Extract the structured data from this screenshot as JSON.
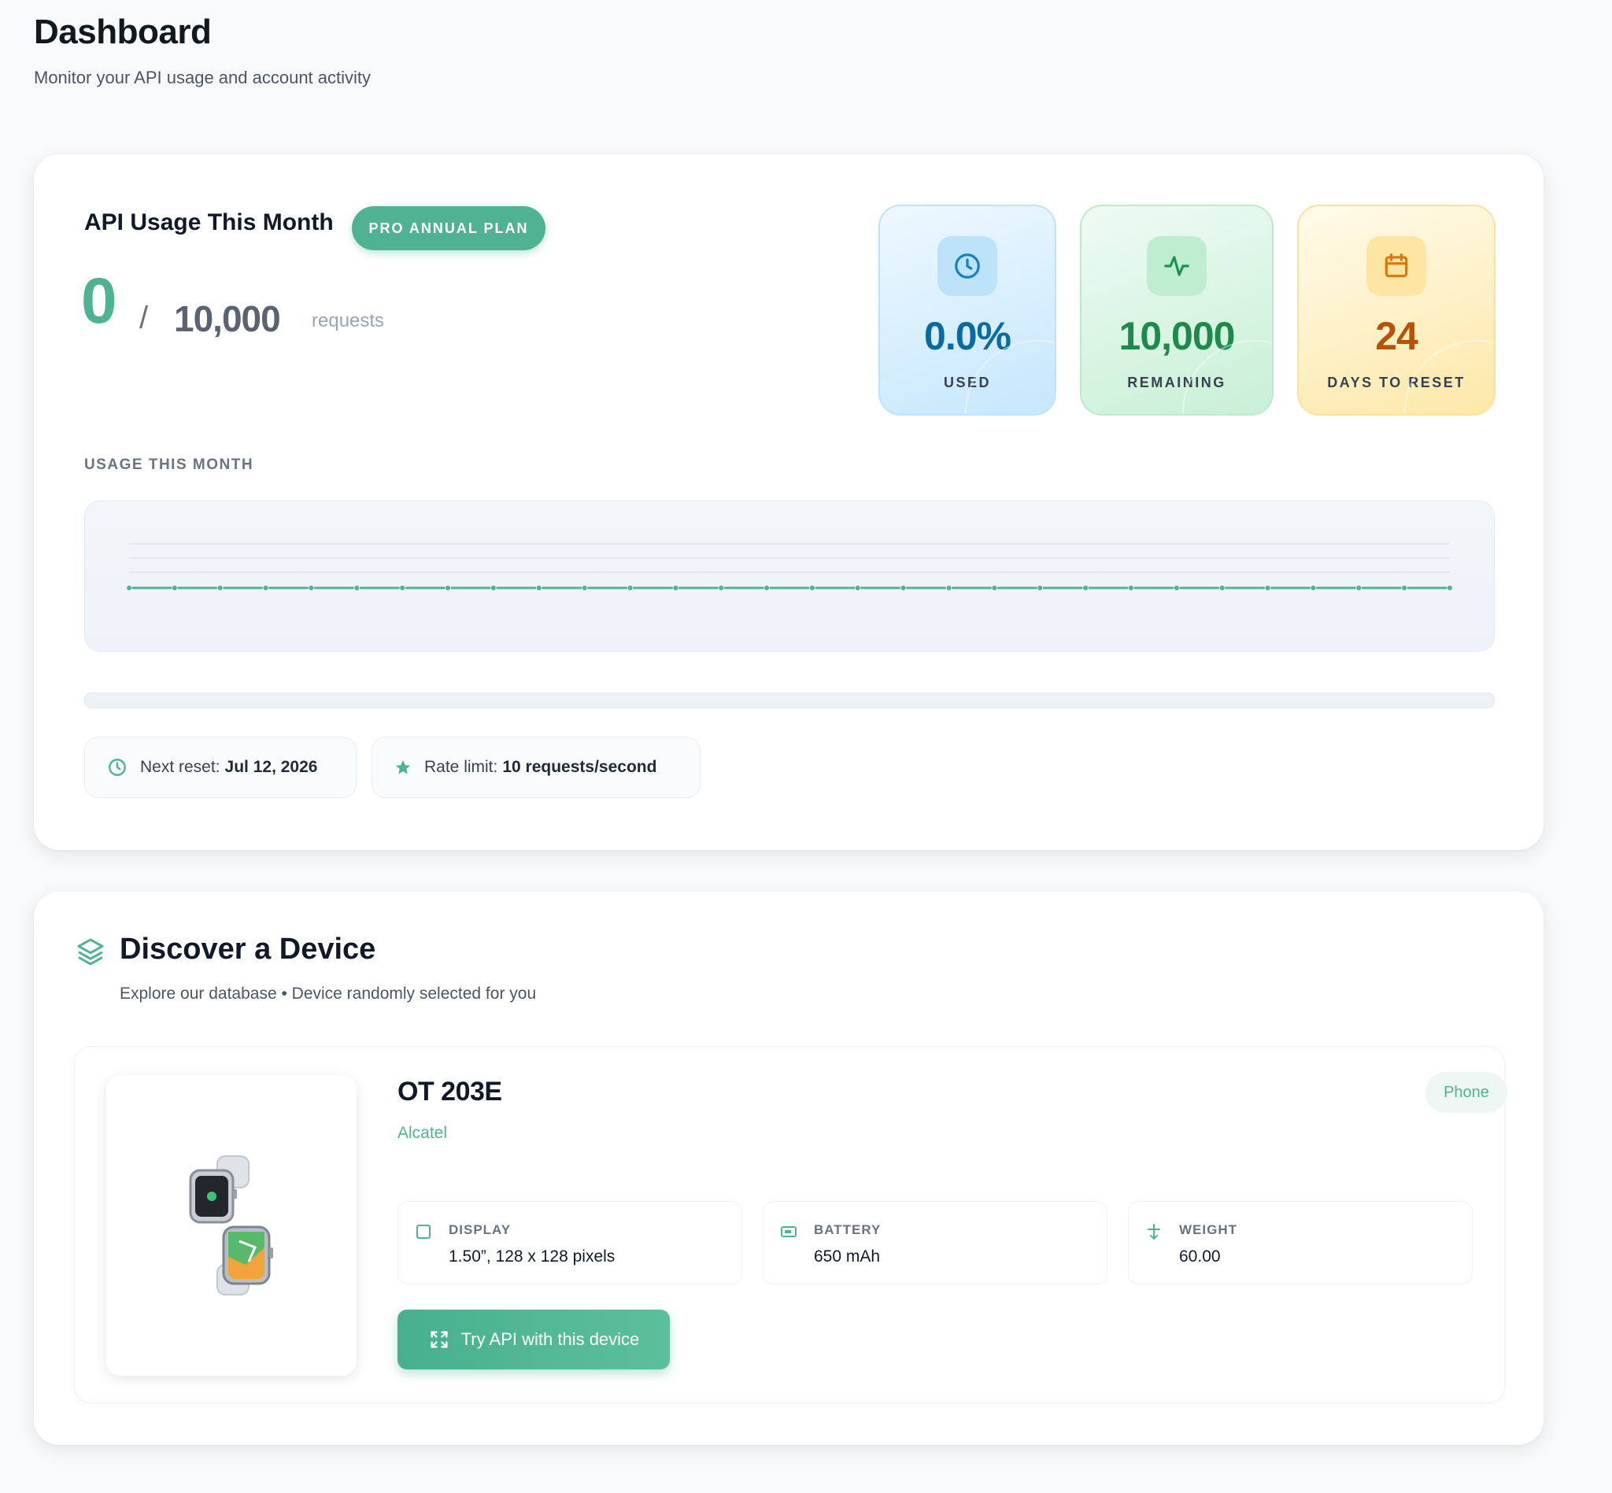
{
  "header": {
    "title": "Dashboard",
    "subtitle": "Monitor your API usage and account activity"
  },
  "usage": {
    "title": "API Usage This Month",
    "plan_badge": "PRO ANNUAL PLAN",
    "used": "0",
    "separator": "/",
    "limit": "10,000",
    "unit": "requests",
    "progress_fraction": 0.0,
    "stats": [
      {
        "icon": "clock-icon",
        "value": "0.0%",
        "label": "USED"
      },
      {
        "icon": "activity-icon",
        "value": "10,000",
        "label": "REMAINING"
      },
      {
        "icon": "calendar-icon",
        "value": "24",
        "label": "DAYS TO RESET"
      }
    ],
    "chart_label": "USAGE THIS MONTH",
    "next_reset_label": "Next reset:",
    "next_reset_value": "Jul 12, 2026",
    "rate_limit_label": "Rate limit:",
    "rate_limit_value": "10 requests/second"
  },
  "chart_data": {
    "type": "line",
    "x": [
      1,
      2,
      3,
      4,
      5,
      6,
      7,
      8,
      9,
      10,
      11,
      12,
      13,
      14,
      15,
      16,
      17,
      18,
      19,
      20,
      21,
      22,
      23,
      24,
      25,
      26,
      27,
      28,
      29,
      30
    ],
    "series": [
      {
        "values": [
          0,
          0,
          0,
          0,
          0,
          0,
          0,
          0,
          0,
          0,
          0,
          0,
          0,
          0,
          0,
          0,
          0,
          0,
          0,
          0,
          0,
          0,
          0,
          0,
          0,
          0,
          0,
          0,
          0,
          0
        ]
      }
    ],
    "grid": true,
    "color": "#4fb393"
  },
  "discover": {
    "title": "Discover a Device",
    "subtitle": "Explore our database • Device randomly selected for you",
    "device": {
      "name": "OT 203E",
      "brand": "Alcatel",
      "type": "Phone",
      "specs": [
        {
          "icon": "display-icon",
          "label": "DISPLAY",
          "value": "1.50”, 128 x 128 pixels"
        },
        {
          "icon": "battery-icon",
          "label": "BATTERY",
          "value": "650 mAh"
        },
        {
          "icon": "weight-icon",
          "label": "WEIGHT",
          "value": "60.00"
        }
      ],
      "try_button": "Try API with this device"
    }
  },
  "colors": {
    "accent": "#4fb393",
    "used": "#0b69a3",
    "remaining": "#1d8a4c",
    "reset": "#b45309"
  }
}
